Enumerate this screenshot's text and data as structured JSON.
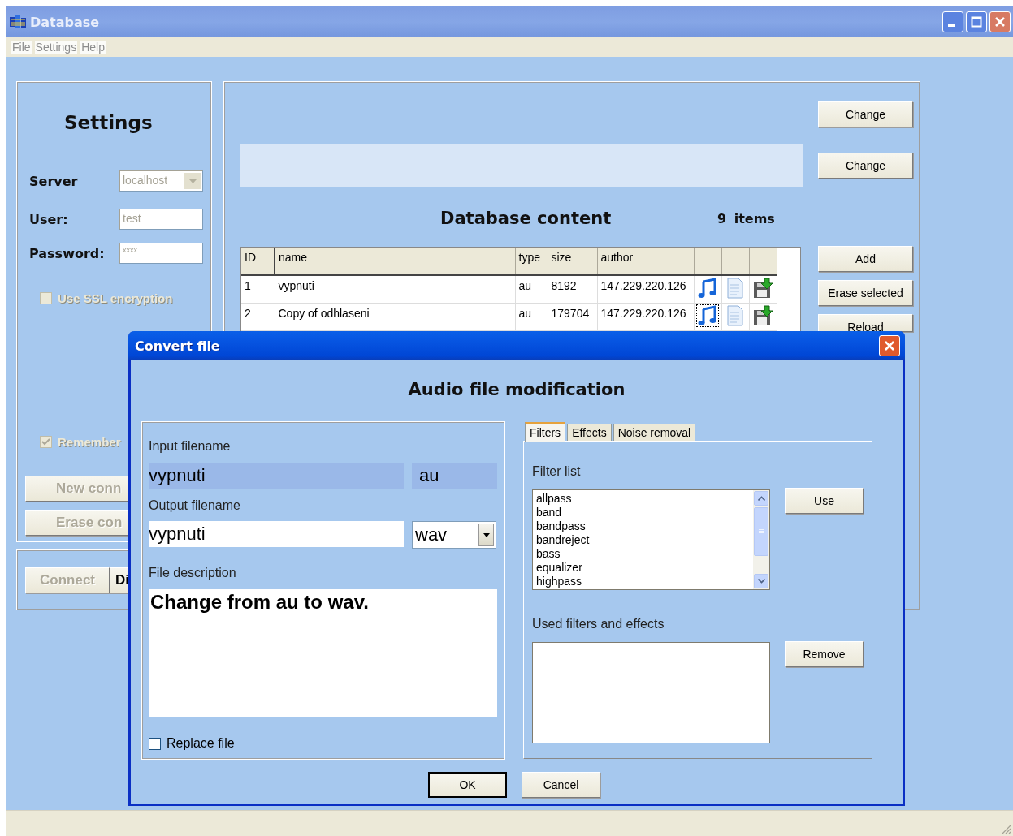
{
  "window": {
    "title": "Database",
    "menu": [
      "File",
      "Settings",
      "Help"
    ]
  },
  "settings": {
    "title": "Settings",
    "server_label": "Server",
    "server": "localhost",
    "user_label": "User:",
    "user": "test",
    "password_label": "Password:",
    "password": "xxxx",
    "ssl": {
      "label": "Use SSL encryption",
      "checked": false,
      "disabled": true
    },
    "remember": {
      "label": "Remember",
      "checked": true,
      "disabled": true
    },
    "buttons": [
      {
        "label": "New conn",
        "disabled": true
      },
      {
        "label": "Erase con",
        "disabled": true
      }
    ],
    "connect_buttons": [
      {
        "label": "Connect",
        "disabled": true
      },
      {
        "label": "Di",
        "disabled": false
      }
    ]
  },
  "content": {
    "top_buttons": [
      "Change",
      "Change"
    ],
    "title": "Database content",
    "count": "9 items",
    "columns": [
      "ID",
      "name",
      "type",
      "size",
      "author"
    ],
    "rows": [
      {
        "id": "1",
        "name": "vypnuti",
        "type": "au",
        "size": "8192",
        "author": "147.229.220.126",
        "focused": false
      },
      {
        "id": "2",
        "name": "Copy of odhlaseni",
        "type": "au",
        "size": "179704",
        "author": "147.229.220.126",
        "focused": true
      }
    ],
    "side_buttons": [
      "Add",
      "Erase selected",
      "Reload"
    ]
  },
  "dialog": {
    "title": "Convert file",
    "heading": "Audio file modification",
    "input_label": "Input filename",
    "input_name": "vypnuti",
    "input_ext": "au",
    "output_label": "Output filename",
    "output_name": "vypnuti",
    "output_format": "wav",
    "description_label": "File description",
    "description": "Change from au to wav.",
    "replace": {
      "label": "Replace file",
      "checked": false
    },
    "tabs": [
      {
        "label": "Filters",
        "selected": true
      },
      {
        "label": "Effects",
        "selected": false
      },
      {
        "label": "Noise removal",
        "selected": false
      }
    ],
    "filter_list_label": "Filter list",
    "filters": [
      "allpass",
      "band",
      "bandpass",
      "bandreject",
      "bass",
      "equalizer",
      "highpass"
    ],
    "use_button": "Use",
    "used_label": "Used filters and effects",
    "remove_button": "Remove",
    "buttons": [
      {
        "label": "OK",
        "default": true
      },
      {
        "label": "Cancel",
        "default": false
      }
    ]
  }
}
